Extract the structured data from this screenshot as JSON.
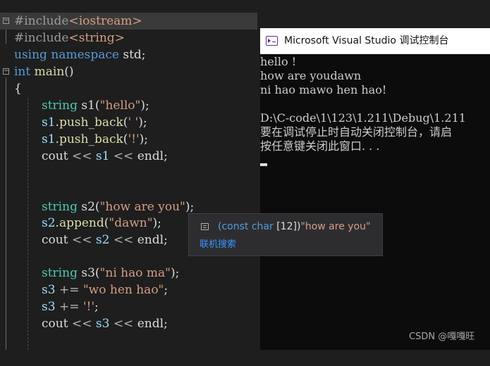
{
  "editor": {
    "lines": [
      [
        "#include",
        "<iostream>"
      ],
      [
        "#include",
        "<string>"
      ],
      [
        "using",
        "namespace",
        "std;"
      ],
      [
        "int",
        "main",
        "()"
      ],
      [
        "{"
      ],
      [
        "string",
        "s1",
        "(",
        "\"hello\"",
        ");"
      ],
      [
        "s1",
        ".",
        "push_back",
        "(",
        "' '",
        ");"
      ],
      [
        "s1",
        ".",
        "push_back",
        "(",
        "'!'",
        ");"
      ],
      [
        "cout",
        "<<",
        "s1",
        "<<",
        "endl",
        ";"
      ],
      [
        "string",
        "s2",
        "(",
        "\"how are you\"",
        ");"
      ],
      [
        "s2",
        ".",
        "append",
        "(",
        "\"dawn\"",
        ");"
      ],
      [
        "cout",
        "<<",
        "s2",
        "<<",
        "endl",
        ";"
      ],
      [
        "string",
        "s3",
        "(",
        "\"ni hao ma\"",
        ");"
      ],
      [
        "s3",
        "+=",
        "\"wo hen hao\"",
        ";"
      ],
      [
        "s3",
        "+=",
        "'!'",
        ";"
      ],
      [
        "cout",
        "<<",
        "s3",
        "<<",
        "endl",
        ";"
      ]
    ]
  },
  "console": {
    "title": "Microsoft Visual Studio 调试控制台",
    "output": [
      "hello !",
      "how are youdawn",
      "ni hao mawo hen hao!",
      "",
      "D:\\C-code\\1\\123\\1.211\\Debug\\1.211",
      "要在调试停止时自动关闭控制台，请启",
      "按任意键关闭此窗口. . ."
    ]
  },
  "tooltip": {
    "signature_type": "(const char",
    "signature_size": " [12])",
    "signature_value": "\"how are you\"",
    "link": "联机搜索"
  },
  "watermark": "CSDN @嘎嘎旺",
  "colors": {
    "background": "#1e1e1e",
    "keyword": "#569cd6",
    "type": "#4ec9b0",
    "function": "#dcdcaa",
    "string": "#d69d85",
    "variable": "#9cdcfe",
    "link": "#3794ff"
  }
}
